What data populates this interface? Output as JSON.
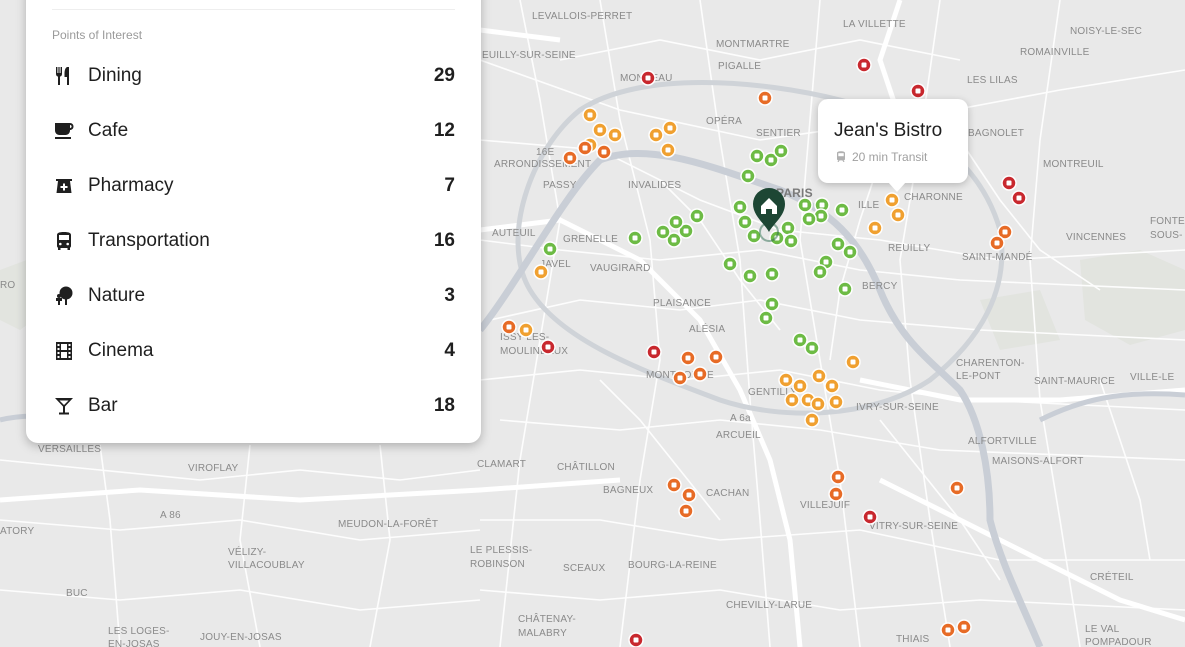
{
  "panel": {
    "heading": "Points of Interest",
    "items": [
      {
        "label": "Dining",
        "count": "29",
        "icon": "fork-knife-icon"
      },
      {
        "label": "Cafe",
        "count": "12",
        "icon": "coffee-cup-icon"
      },
      {
        "label": "Pharmacy",
        "count": "7",
        "icon": "pharmacy-icon"
      },
      {
        "label": "Transportation",
        "count": "16",
        "icon": "bus-icon"
      },
      {
        "label": "Nature",
        "count": "3",
        "icon": "tree-icon"
      },
      {
        "label": "Cinema",
        "count": "4",
        "icon": "film-icon"
      },
      {
        "label": "Bar",
        "count": "18",
        "icon": "cocktail-glass-icon"
      }
    ]
  },
  "tooltip": {
    "title": "Jean's Bistro",
    "subtitle": "20 min Transit",
    "icon": "train-icon"
  },
  "home_marker": {
    "icon": "home-icon"
  },
  "colors": {
    "near": "#6dbb45",
    "mid": "#f0a030",
    "far": "#e76b26",
    "farthest": "#c8282e",
    "home": "#1d4634",
    "home_ring": "#2e6b4f"
  },
  "map_labels": [
    {
      "id": "levallois",
      "text": "LEVALLOIS-PERRET"
    },
    {
      "id": "lavillette",
      "text": "LA VILLETTE"
    },
    {
      "id": "noisy",
      "text": "NOISY-LE-SEC"
    },
    {
      "id": "romainville",
      "text": "ROMAINVILLE"
    },
    {
      "id": "neuilly",
      "text": "EUILLY-SUR-SEINE"
    },
    {
      "id": "montmartre",
      "text": "MONTMARTRE"
    },
    {
      "id": "pigalle",
      "text": "PIGALLE"
    },
    {
      "id": "lesl",
      "text": "LES LILAS"
    },
    {
      "id": "monceau",
      "text": "MONCEAU"
    },
    {
      "id": "opera",
      "text": "OPÉRA"
    },
    {
      "id": "sentier",
      "text": "SENTIER"
    },
    {
      "id": "bagnolet",
      "text": "BAGNOLET"
    },
    {
      "id": "16e",
      "text": "16E"
    },
    {
      "id": "arrond",
      "text": "ARRONDISSEMENT"
    },
    {
      "id": "passy",
      "text": "PASSY"
    },
    {
      "id": "invalides",
      "text": "INVALIDES"
    },
    {
      "id": "paris",
      "text": "PARIS"
    },
    {
      "id": "montreuil",
      "text": "MONTREUIL"
    },
    {
      "id": "charonne",
      "text": "CHARONNE"
    },
    {
      "id": "fonte",
      "text": "FONTE"
    },
    {
      "id": "sous",
      "text": "SOUS-"
    },
    {
      "id": "auteuil",
      "text": "AUTEUIL"
    },
    {
      "id": "grenelle",
      "text": "GRENELLE"
    },
    {
      "id": "vincennes",
      "text": "VINCENNES"
    },
    {
      "id": "reuilly",
      "text": "REUILLY"
    },
    {
      "id": "javel",
      "text": "JAVEL"
    },
    {
      "id": "vaugirard",
      "text": "VAUGIRARD"
    },
    {
      "id": "saintmande",
      "text": "SAINT-MANDÉ"
    },
    {
      "id": "bercy",
      "text": "BERCY"
    },
    {
      "id": "plaisance",
      "text": "PLAISANCE"
    },
    {
      "id": "alesia",
      "text": "ALÉSIA"
    },
    {
      "id": "issy",
      "text": "ISSY-LES-"
    },
    {
      "id": "moulineaux",
      "text": "MOULINEAUX"
    },
    {
      "id": "montrouge",
      "text": "MONTROUGE"
    },
    {
      "id": "gentilly",
      "text": "GENTILLY"
    },
    {
      "id": "charenton",
      "text": "CHARENTON-"
    },
    {
      "id": "lepont",
      "text": "LE-PONT"
    },
    {
      "id": "saintmaurice",
      "text": "SAINT-MAURICE"
    },
    {
      "id": "ville",
      "text": "VILLE-LE"
    },
    {
      "id": "ivry",
      "text": "IVRY-SUR-SEINE"
    },
    {
      "id": "a6a",
      "text": "A 6a"
    },
    {
      "id": "arcueil",
      "text": "ARCUEIL"
    },
    {
      "id": "alfortville",
      "text": "ALFORTVILLE"
    },
    {
      "id": "maisons",
      "text": "MAISONS-ALFORT"
    },
    {
      "id": "versailles",
      "text": "VERSAILLES"
    },
    {
      "id": "viroflay",
      "text": "VIROFLAY"
    },
    {
      "id": "clamart",
      "text": "CLAMART"
    },
    {
      "id": "chatillon",
      "text": "CHÂTILLON"
    },
    {
      "id": "bagneux",
      "text": "BAGNEUX"
    },
    {
      "id": "cachan",
      "text": "CACHAN"
    },
    {
      "id": "villejuif",
      "text": "VILLEJUIF"
    },
    {
      "id": "vitry",
      "text": "VITRY-SUR-SEINE"
    },
    {
      "id": "atory",
      "text": "ATORY"
    },
    {
      "id": "a86",
      "text": "A 86"
    },
    {
      "id": "meudon",
      "text": "MEUDON-LA-FORÊT"
    },
    {
      "id": "velizy",
      "text": "VÉLIZY-"
    },
    {
      "id": "villacoublay",
      "text": "VILLACOUBLAY"
    },
    {
      "id": "plessis",
      "text": "LE PLESSIS-"
    },
    {
      "id": "robinson",
      "text": "ROBINSON"
    },
    {
      "id": "sceaux",
      "text": "SCEAUX"
    },
    {
      "id": "bourg",
      "text": "BOURG-LA-REINE"
    },
    {
      "id": "creteil",
      "text": "CRÉTEIL"
    },
    {
      "id": "buc",
      "text": "BUC"
    },
    {
      "id": "chevilly",
      "text": "CHEVILLY-LARUE"
    },
    {
      "id": "lesloges",
      "text": "LES LOGES-"
    },
    {
      "id": "enjosas",
      "text": "EN-JOSAS"
    },
    {
      "id": "jouy",
      "text": "JOUY-EN-JOSAS"
    },
    {
      "id": "chatenay",
      "text": "CHÂTENAY-"
    },
    {
      "id": "malabry",
      "text": "MALABRY"
    },
    {
      "id": "thiais",
      "text": "THIAIS"
    },
    {
      "id": "levallabel",
      "text": "LE VAL"
    },
    {
      "id": "pompadour",
      "text": "POMPADOUR"
    },
    {
      "id": "ro",
      "text": "RO"
    },
    {
      "id": "ille",
      "text": "ILLE"
    }
  ]
}
